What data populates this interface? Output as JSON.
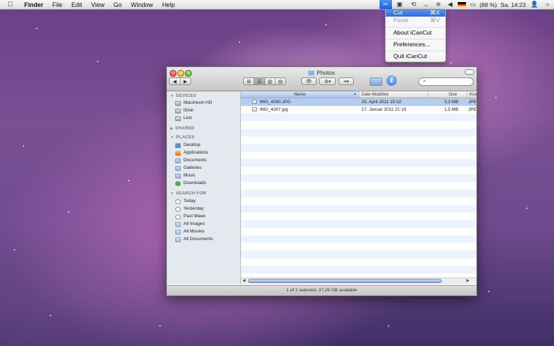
{
  "menubar": {
    "apple_icon": "apple-icon",
    "items": [
      "Finder",
      "File",
      "Edit",
      "View",
      "Go",
      "Window",
      "Help"
    ],
    "battery_text": "(88 %)",
    "clock_text": "Sa. 14:23"
  },
  "dropdown": {
    "items": [
      {
        "label": "Cut",
        "shortcut": "⌘X"
      },
      {
        "label": "Paste",
        "shortcut": "⌘V"
      },
      {
        "label": "About iCanCut",
        "shortcut": ""
      },
      {
        "label": "Preferences...",
        "shortcut": ""
      },
      {
        "label": "Quit iCanCut",
        "shortcut": ""
      }
    ]
  },
  "window": {
    "title": "Photos",
    "search_placeholder": "",
    "status": "1 of 2 selected, 37,26 GB available",
    "columns": [
      "Name",
      "Date Modified",
      "Size",
      "Kind"
    ],
    "files": [
      {
        "name": "IMG_4280.JPG",
        "date": "20. April 2011 15:32",
        "size": "3,3 MB",
        "kind": "JPEG",
        "selected": true
      },
      {
        "name": "IMG_4287.jpg",
        "date": "27. Januar 2011 21:19",
        "size": "1,5 MB",
        "kind": "JPEG",
        "selected": false
      }
    ]
  },
  "sidebar": {
    "sections": [
      {
        "header": "DEVICES",
        "items": [
          {
            "label": "Macintosh HD",
            "icon": "hard-disk-icon"
          },
          {
            "label": "iDisk",
            "icon": "idisk-icon"
          },
          {
            "label": "Lion",
            "icon": "disk-icon"
          }
        ]
      },
      {
        "header": "SHARED",
        "items": []
      },
      {
        "header": "PLACES",
        "items": [
          {
            "label": "Desktop",
            "icon": "desktop-icon"
          },
          {
            "label": "Applications",
            "icon": "applications-icon"
          },
          {
            "label": "Documents",
            "icon": "documents-icon"
          },
          {
            "label": "Galleries",
            "icon": "folder-icon"
          },
          {
            "label": "Music",
            "icon": "music-icon"
          },
          {
            "label": "Downloads",
            "icon": "downloads-icon"
          }
        ]
      },
      {
        "header": "SEARCH FOR",
        "items": [
          {
            "label": "Today",
            "icon": "clock-icon"
          },
          {
            "label": "Yesterday",
            "icon": "clock-icon"
          },
          {
            "label": "Past Week",
            "icon": "clock-icon"
          },
          {
            "label": "All Images",
            "icon": "smart-folder-icon"
          },
          {
            "label": "All Movies",
            "icon": "smart-folder-icon"
          },
          {
            "label": "All Documents",
            "icon": "smart-folder-icon"
          }
        ]
      }
    ]
  }
}
